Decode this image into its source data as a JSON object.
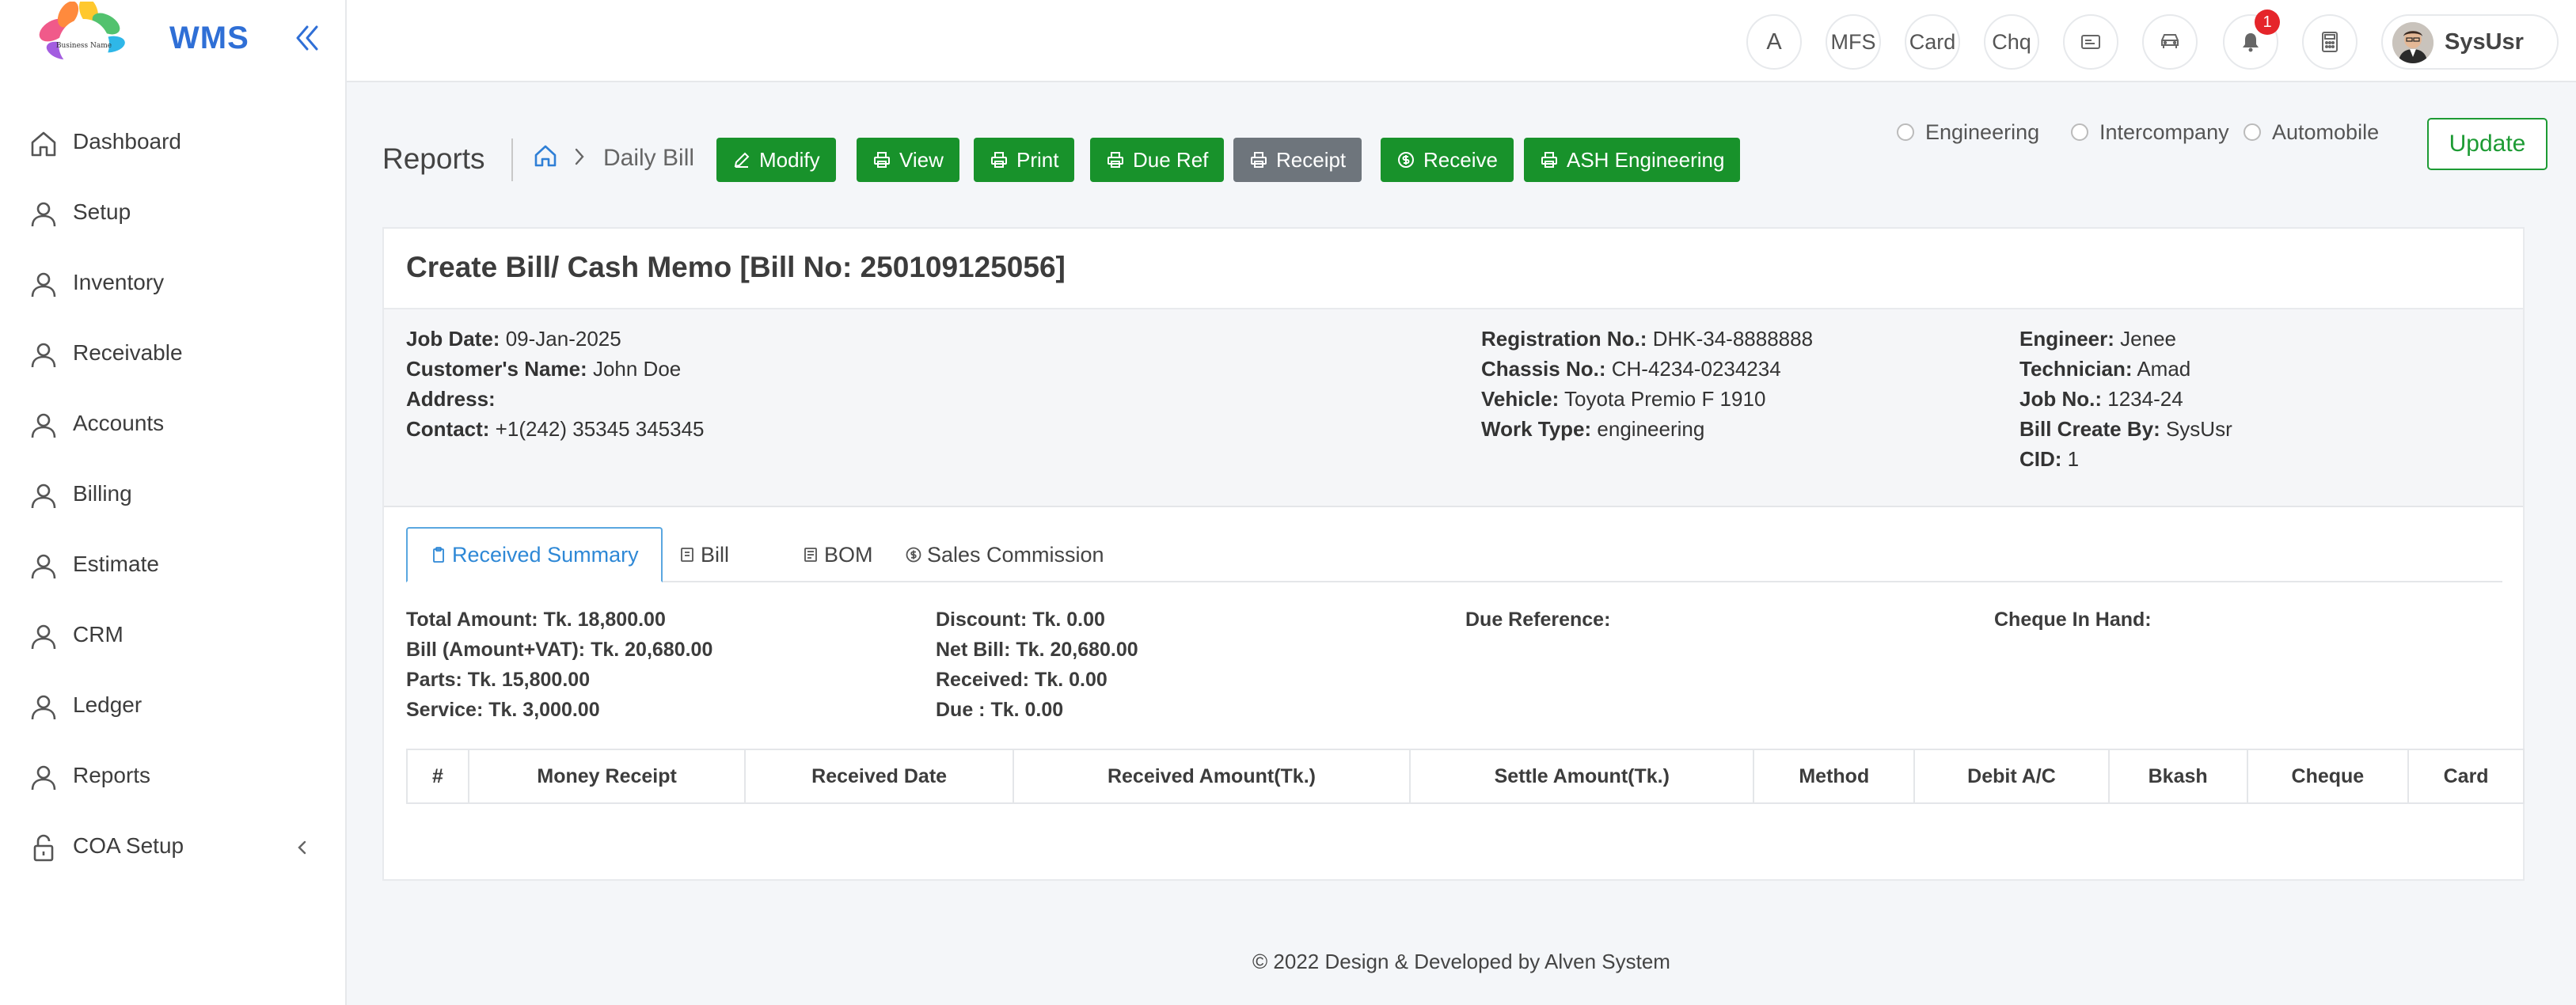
{
  "app": {
    "brand_name": "WMS",
    "logo_text": "Business Name"
  },
  "sidebar": {
    "items": [
      {
        "label": "Dashboard",
        "icon": "home-icon"
      },
      {
        "label": "Setup",
        "icon": "user-icon"
      },
      {
        "label": "Inventory",
        "icon": "user-icon"
      },
      {
        "label": "Receivable",
        "icon": "user-icon"
      },
      {
        "label": "Accounts",
        "icon": "user-icon"
      },
      {
        "label": "Billing",
        "icon": "user-icon"
      },
      {
        "label": "Estimate",
        "icon": "user-icon"
      },
      {
        "label": "CRM",
        "icon": "user-icon"
      },
      {
        "label": "Ledger",
        "icon": "user-icon"
      },
      {
        "label": "Reports",
        "icon": "user-icon"
      },
      {
        "label": "COA Setup",
        "icon": "lock-icon"
      }
    ]
  },
  "topbar": {
    "buttons": [
      "A",
      "MFS",
      "Card",
      "Chq"
    ],
    "notification_count": "1",
    "user_name": "SysUsr"
  },
  "header": {
    "title": "Reports",
    "breadcrumb_current": "Daily Bill",
    "actions": {
      "modify": "Modify",
      "view": "View",
      "print": "Print",
      "due_ref": "Due Ref",
      "receipt": "Receipt",
      "receive": "Receive",
      "ash": "ASH Engineering"
    },
    "radio_options": [
      "Engineering",
      "Intercompany",
      "Automobile"
    ],
    "update": "Update"
  },
  "bill": {
    "title": "Create Bill/ Cash Memo [Bill No: 250109125056]",
    "info": {
      "col1": [
        {
          "k": "Job Date:",
          "v": "09-Jan-2025"
        },
        {
          "k": "Customer's Name:",
          "v": "John Doe"
        },
        {
          "k": "Address:",
          "v": ""
        },
        {
          "k": "Contact:",
          "v": "+1(242) 35345 345345"
        }
      ],
      "col2": [
        {
          "k": "Registration No.:",
          "v": "DHK-34-8888888"
        },
        {
          "k": "Chassis No.:",
          "v": "CH-4234-0234234"
        },
        {
          "k": "Vehicle:",
          "v": "Toyota Premio F 1910"
        },
        {
          "k": "Work Type:",
          "v": "engineering"
        }
      ],
      "col3": [
        {
          "k": "Engineer:",
          "v": "Jenee"
        },
        {
          "k": "Technician:",
          "v": "Amad"
        },
        {
          "k": "Job No.:",
          "v": "1234-24"
        },
        {
          "k": "Bill Create By:",
          "v": "SysUsr"
        },
        {
          "k": "CID:",
          "v": "1"
        }
      ]
    },
    "tabs": [
      "Received Summary",
      "Bill",
      "BOM",
      "Sales Commission"
    ],
    "summary": {
      "col1": [
        "Total Amount: Tk. 18,800.00",
        "Bill (Amount+VAT): Tk. 20,680.00",
        "Parts: Tk. 15,800.00",
        "Service: Tk. 3,000.00"
      ],
      "col2": [
        "Discount: Tk. 0.00",
        "Net Bill: Tk. 20,680.00",
        "Received: Tk. 0.00",
        "Due : Tk. 0.00"
      ],
      "col3": [
        "Due Reference:"
      ],
      "col4": [
        "Cheque In Hand:"
      ]
    },
    "table_headers": [
      "#",
      "Money Receipt",
      "Received Date",
      "Received Amount(Tk.)",
      "Settle Amount(Tk.)",
      "Method",
      "Debit A/C",
      "Bkash",
      "Cheque",
      "Card"
    ]
  },
  "footer": "© 2022 Design & Developed by Alven System"
}
